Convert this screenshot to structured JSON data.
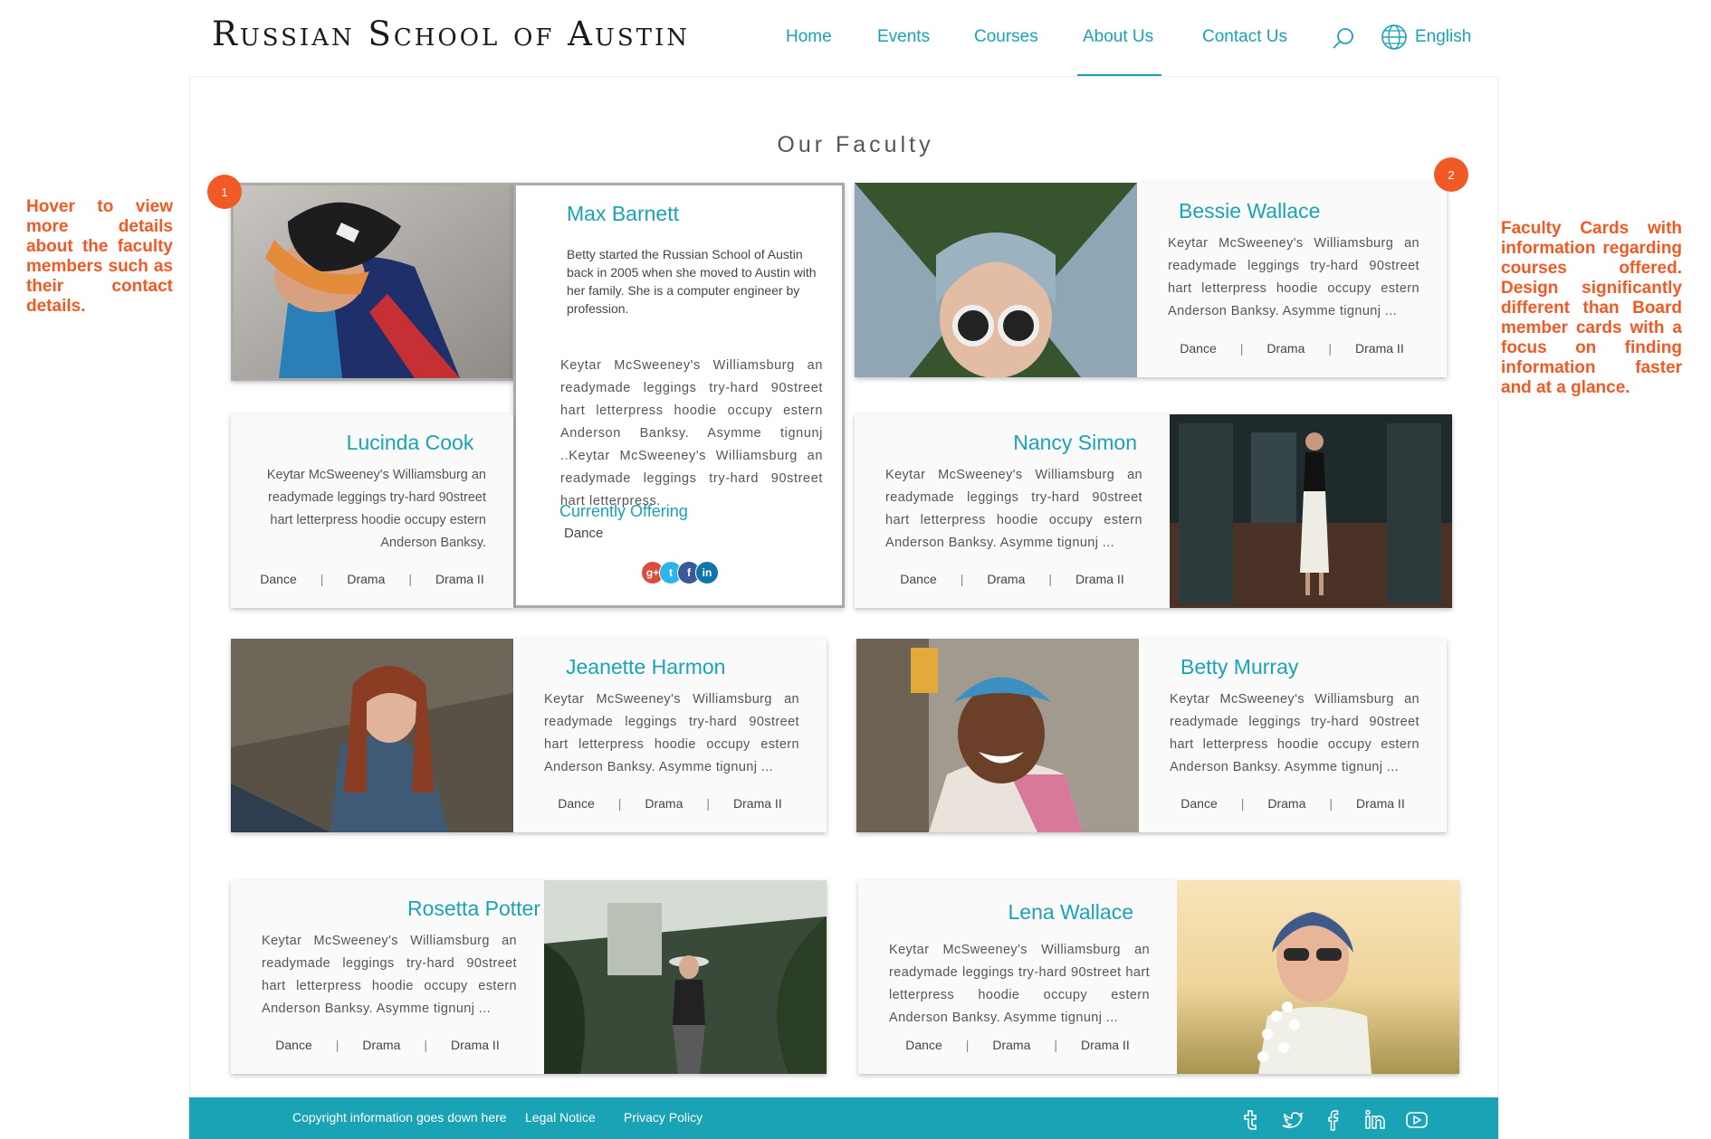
{
  "header": {
    "logo": "Russian School of Austin",
    "nav": [
      "Home",
      "Events",
      "Courses",
      "About Us",
      "Contact Us"
    ],
    "active_nav": "About Us",
    "language": "English"
  },
  "page": {
    "title": "Our Faculty"
  },
  "annotations": {
    "left": "Hover to view more details about the faculty members such as their contact details.",
    "right": "Faculty Cards with information regarding courses offered. Design significantly different than Board member cards with a focus on finding information faster and at a glance.",
    "marker1": "1",
    "marker2": "2"
  },
  "expanded": {
    "name": "Max Barnett",
    "bio": "Betty started the Russian School of Austin back in 2005 when she moved to Austin with her family. She is a computer engineer by profession.",
    "desc": "Keytar McSweeney's Williamsburg an readymade leggings try-hard 90street hart letterpress hoodie occupy estern Anderson Banksy. Asymme tignunj ..Keytar McSweeney's Williamsburg an readymade leggings try-hard 90street hart letterpress.",
    "offering_label": "Currently Offering",
    "offering": "Dance",
    "social": [
      "g+",
      "t",
      "f",
      "in"
    ]
  },
  "faculty": [
    {
      "name": "Bessie Wallace",
      "desc": "Keytar McSweeney's Williamsburg an readymade leggings try-hard 90street hart letterpress hoodie occupy estern Anderson Banksy. Asymme tignunj ...",
      "tags": [
        "Dance",
        "Drama",
        "Drama II"
      ]
    },
    {
      "name": "Lucinda Cook",
      "desc": "Keytar McSweeney's Williamsburg an readymade leggings try-hard 90street hart letterpress hoodie occupy estern Anderson Banksy.",
      "tags": [
        "Dance",
        "Drama",
        "Drama II"
      ]
    },
    {
      "name": "Nancy Simon",
      "desc": "Keytar McSweeney's Williamsburg an readymade leggings try-hard 90street hart letterpress hoodie occupy estern Anderson Banksy. Asymme tignunj ...",
      "tags": [
        "Dance",
        "Drama",
        "Drama II"
      ]
    },
    {
      "name": "Jeanette Harmon",
      "desc": "Keytar McSweeney's Williamsburg an readymade leggings try-hard 90street hart letterpress hoodie occupy estern Anderson Banksy. Asymme tignunj ...",
      "tags": [
        "Dance",
        "Drama",
        "Drama II"
      ]
    },
    {
      "name": "Betty Murray",
      "desc": "Keytar McSweeney's Williamsburg an readymade leggings try-hard 90street hart letterpress hoodie occupy estern Anderson Banksy. Asymme tignunj ...",
      "tags": [
        "Dance",
        "Drama",
        "Drama II"
      ]
    },
    {
      "name": "Rosetta Potter",
      "desc": "Keytar McSweeney's Williamsburg an readymade leggings try-hard 90street hart letterpress hoodie occupy estern Anderson Banksy. Asymme tignunj ...",
      "tags": [
        "Dance",
        "Drama",
        "Drama II"
      ]
    },
    {
      "name": "Lena Wallace",
      "desc": "Keytar McSweeney's Williamsburg an readymade leggings try-hard 90street hart letterpress hoodie occupy estern Anderson Banksy. Asymme tignunj ...",
      "tags": [
        "Dance",
        "Drama",
        "Drama II"
      ]
    }
  ],
  "footer": {
    "copyright": "Copyright information goes down here",
    "legal": "Legal Notice",
    "privacy": "Privacy Policy",
    "social_icons": [
      "tumblr-icon",
      "twitter-icon",
      "facebook-icon",
      "linkedin-icon",
      "youtube-icon"
    ]
  },
  "colors": {
    "accent": "#1aa3b5",
    "annotation": "#f15a24"
  }
}
